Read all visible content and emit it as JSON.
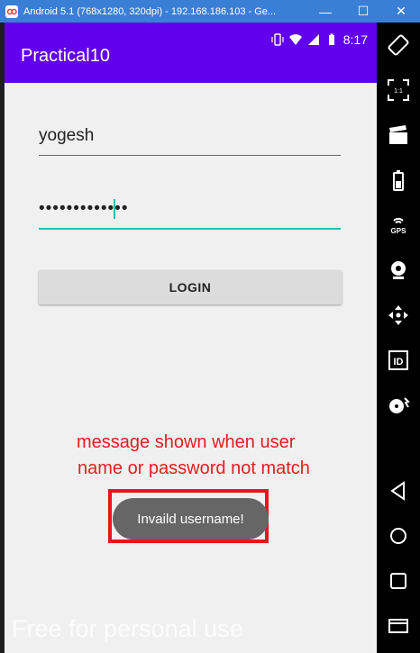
{
  "window": {
    "title": "Android 5.1 (768x1280, 320dpi) - 192.168.186.103 - Ge...",
    "minimize": "—",
    "maximize": "☐",
    "close": "✕"
  },
  "status_bar": {
    "time": "8:17"
  },
  "app": {
    "title": "Practical10"
  },
  "form": {
    "username_value": "yogesh",
    "password_value": "•••••••••••••",
    "login_label": "LOGIN"
  },
  "annotation": {
    "line1": "message shown when user",
    "line2": "name or password not match"
  },
  "toast": {
    "message": "Invaild username!"
  },
  "watermark": "Free for personal use",
  "toolbar": {
    "gps_label": "GPS",
    "id_label": "ID",
    "scale_label": "1:1"
  },
  "colors": {
    "app_bar": "#6200ee",
    "accent": "#26bfae",
    "annotation": "#e02020",
    "highlight": "#e8151c",
    "toast": "#666666"
  }
}
